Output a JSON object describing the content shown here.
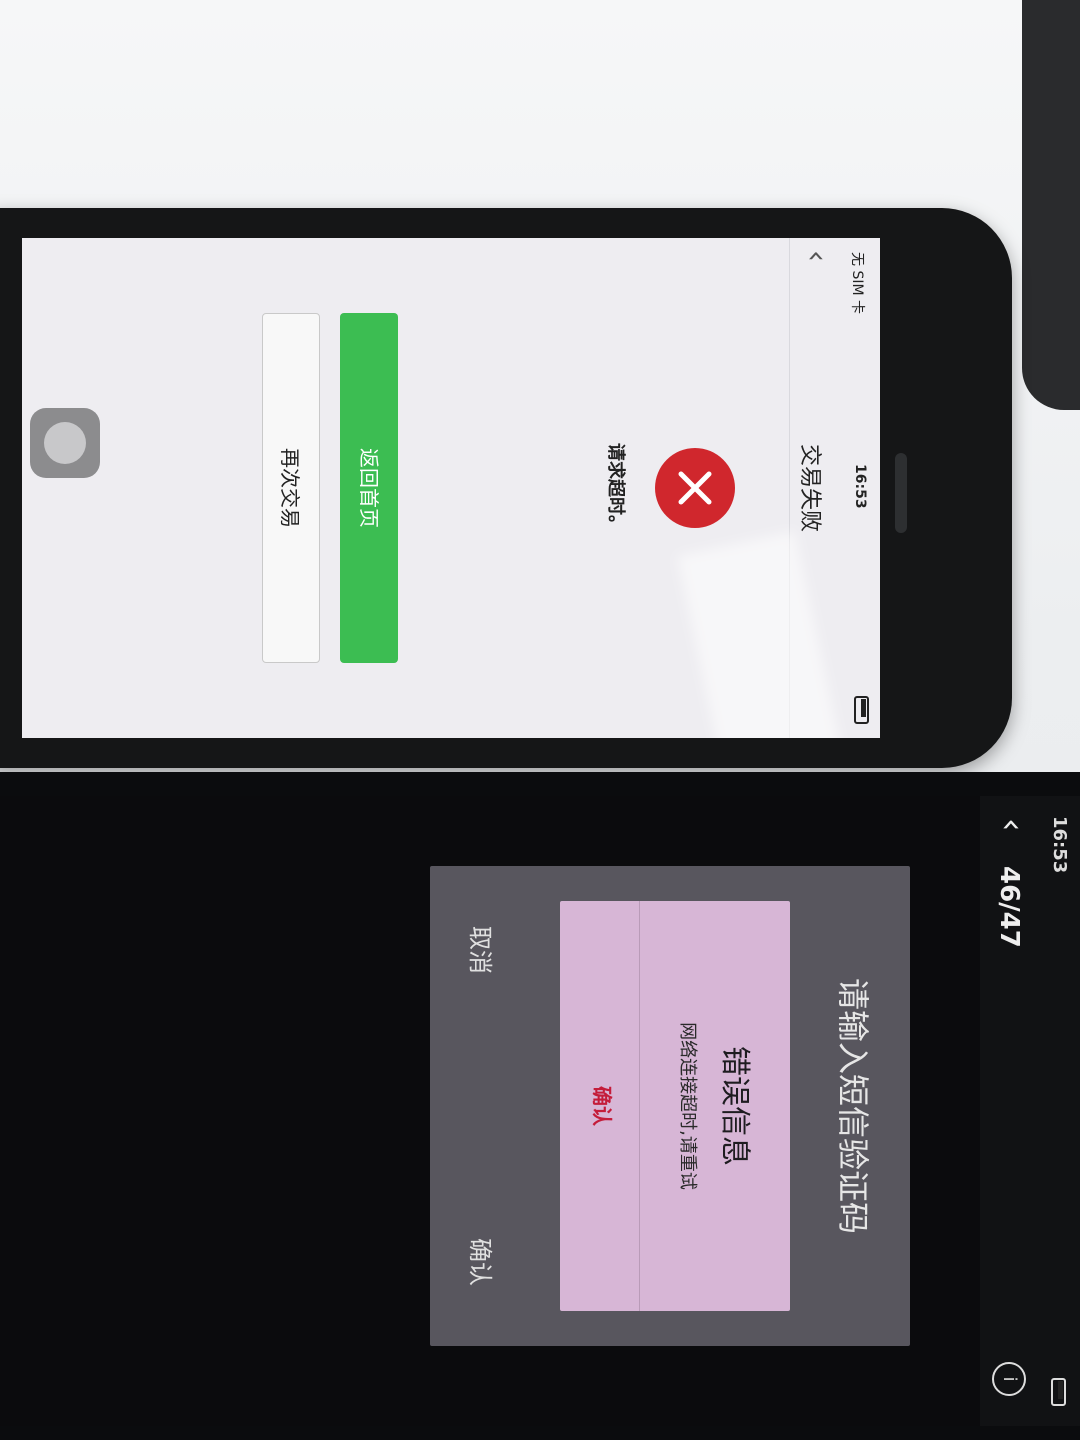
{
  "top_phone": {
    "status": {
      "carrier": "无 SIM 卡",
      "time": "16:53"
    },
    "nav": {
      "back_icon": "chevron-left-icon",
      "title": "交易失败"
    },
    "result": {
      "icon": "error-x-icon",
      "icon_color": "#d0272d",
      "message": "请求超时。"
    },
    "buttons": {
      "primary_label": "返回首页",
      "primary_color": "#3cbd52",
      "secondary_label": "再次交易"
    }
  },
  "bottom_phone": {
    "status": {
      "time": "16:53"
    },
    "nav": {
      "back_icon": "chevron-left-icon",
      "counter": "46/47",
      "info_icon": "info-icon"
    },
    "sms_dialog": {
      "title": "请输入短信验证码",
      "cancel_label": "取消",
      "confirm_label": "确认"
    },
    "error_dialog": {
      "title": "错误信息",
      "message": "网络连接超时,请重试",
      "confirm_label": "确认",
      "confirm_color": "#c41c3a"
    }
  }
}
